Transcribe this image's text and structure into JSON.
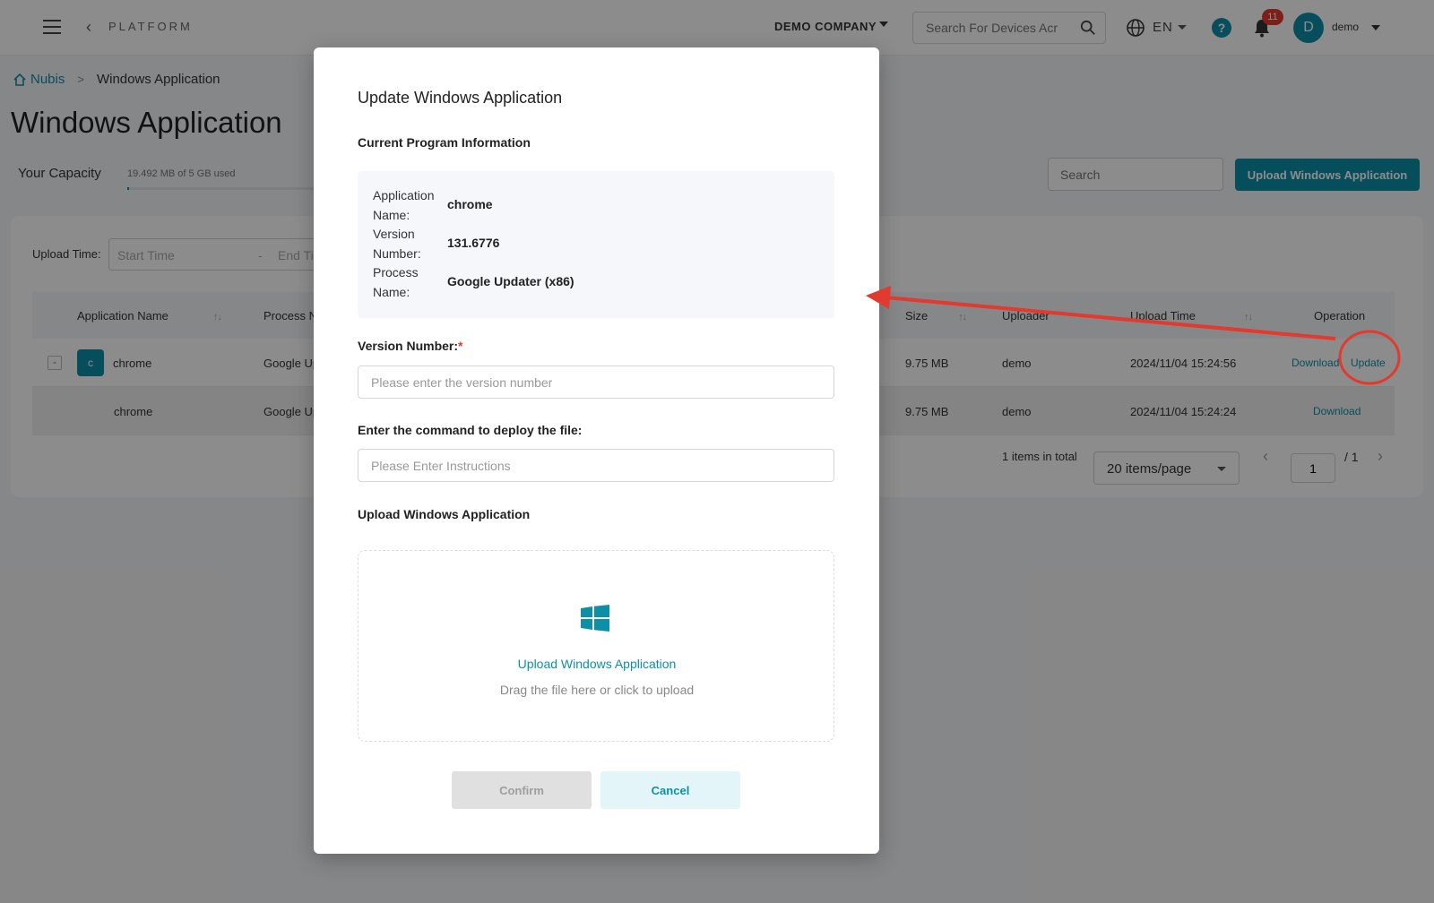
{
  "topbar": {
    "platform": "PLATFORM",
    "company": "DEMO COMPANY",
    "device_search_placeholder": "Search For Devices Acr",
    "lang": "EN",
    "help": "?",
    "notifications": "11",
    "avatar_initial": "D",
    "username": "demo"
  },
  "breadcrumb": {
    "home": "Nubis",
    "sep": ">",
    "current": "Windows Application"
  },
  "page": {
    "title": "Windows Application",
    "capacity_label": "Your Capacity",
    "capacity_text": "19.492 MB of 5 GB used",
    "capacity_fraction": 0.004,
    "search_placeholder": "Search",
    "upload_button": "Upload Windows Application",
    "upload_time_label": "Upload Time:",
    "start_time": "Start Time",
    "range_dash": "-",
    "end_time": "End Ti"
  },
  "table": {
    "headers": {
      "app_name": "Application Name",
      "process": "Process N",
      "size": "Size",
      "uploader": "Uploader",
      "upload_time": "Upload Time",
      "operation": "Operation",
      "sort": "↑↓"
    },
    "rows": [
      {
        "toggle": "-",
        "tile": "c",
        "app": "chrome",
        "process": "Google Up",
        "size": "9.75 MB",
        "uploader": "demo",
        "time": "2024/11/04 15:24:56",
        "download": "Download",
        "update": "Update"
      },
      {
        "app": "chrome",
        "process": "Google Up",
        "size": "9.75 MB",
        "uploader": "demo",
        "time": "2024/11/04 15:24:24",
        "download": "Download"
      }
    ]
  },
  "pagination": {
    "total": "1 items in total",
    "page_size": "20 items/page",
    "page": "1",
    "of": "/ 1"
  },
  "modal": {
    "title": "Update Windows Application",
    "current_info_heading": "Current Program Information",
    "info": {
      "app_name_key": "Application Name:",
      "app_name_val": "chrome",
      "version_key": "Version Number:",
      "version_val": "131.6776",
      "process_key": "Process Name:",
      "process_val": "Google Updater (x86)"
    },
    "version_label": "Version Number:",
    "required_mark": "*",
    "version_placeholder": "Please enter the version number",
    "command_label": "Enter the command to deploy the file:",
    "command_placeholder": "Please Enter Instructions",
    "upload_heading": "Upload Windows Application",
    "dropzone_title": "Upload Windows Application",
    "dropzone_sub": "Drag the file here or click to upload",
    "confirm": "Confirm",
    "cancel": "Cancel"
  },
  "colors": {
    "accent": "#0e8fa8",
    "annotation": "#e23a2e",
    "badge": "#e23a2e"
  }
}
